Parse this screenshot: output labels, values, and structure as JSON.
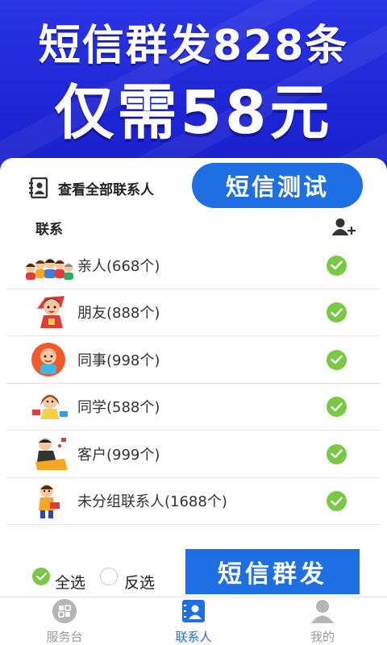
{
  "banner": {
    "line1": "短信群发828条",
    "line2": "仅需58元"
  },
  "header": {
    "view_all_label": "查看全部联系人",
    "sms_test_button": "短信测试"
  },
  "section": {
    "label": "联系"
  },
  "contacts": [
    {
      "name": "亲人(668个)",
      "icon": "family-avatar-icon",
      "checked": true
    },
    {
      "name": "朋友(888个)",
      "icon": "friend-avatar-icon",
      "checked": true
    },
    {
      "name": "同事(998个)",
      "icon": "colleague-avatar-icon",
      "checked": true
    },
    {
      "name": "同学(588个)",
      "icon": "classmate-avatar-icon",
      "checked": true
    },
    {
      "name": "客户(999个)",
      "icon": "customer-avatar-icon",
      "checked": true
    },
    {
      "name": "未分组联系人(1688个)",
      "icon": "ungrouped-avatar-icon",
      "checked": true
    }
  ],
  "footer": {
    "select_all_label": "全选",
    "invert_select_label": "反选",
    "sms_send_button": "短信群发"
  },
  "tabs": [
    {
      "label": "服务台",
      "icon": "service-desk-icon",
      "active": false
    },
    {
      "label": "联系人",
      "icon": "contacts-icon",
      "active": true
    },
    {
      "label": "我的",
      "icon": "profile-icon",
      "active": false
    }
  ],
  "colors": {
    "banner_blue": "#1d24d4",
    "accent_blue": "#1e6fe3",
    "check_green": "#7ac944",
    "inactive_gray": "#9b9b9b"
  }
}
